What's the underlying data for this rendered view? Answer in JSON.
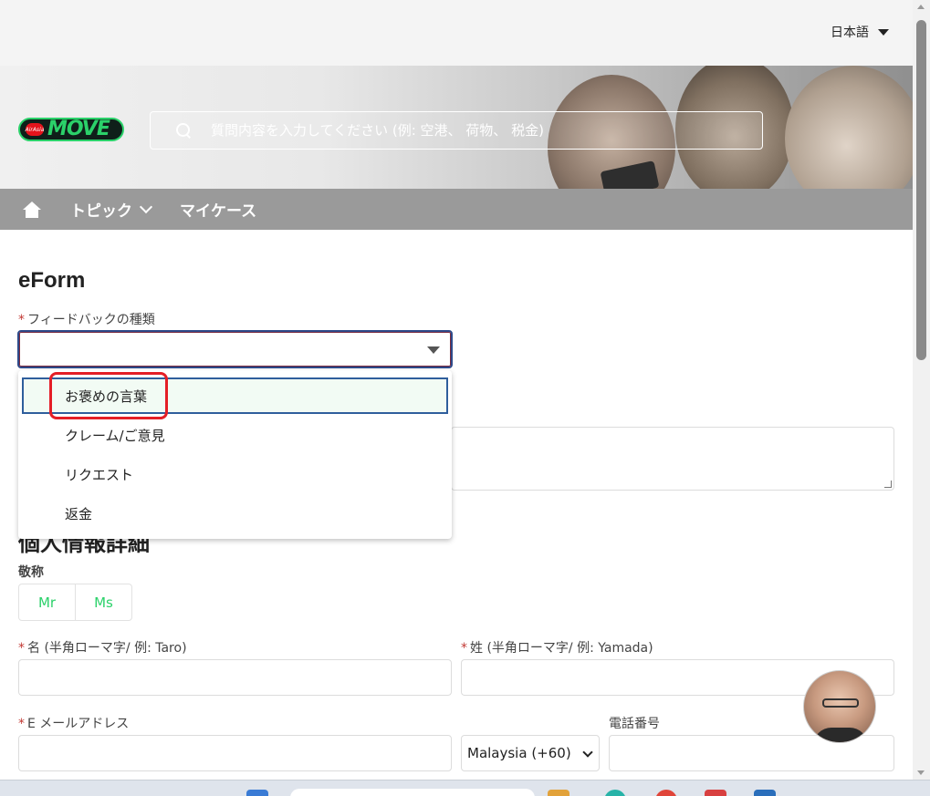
{
  "header": {
    "language": "日本語"
  },
  "search": {
    "placeholder": "質問内容を入力してください (例: 空港、 荷物、 税金)"
  },
  "nav": {
    "topics": "トピック",
    "my_cases": "マイケース"
  },
  "form": {
    "title": "eForm",
    "feedback_type_label": "フィードバックの種類",
    "feedback_options": [
      "お褒めの言葉",
      "クレーム/ご意見",
      "リクエスト",
      "返金"
    ],
    "selected_option_index": 0,
    "section_title": "個人情報詳細",
    "salutation_label": "敬称",
    "salutations": [
      "Mr",
      "Ms"
    ],
    "first_name_label": "名 (半角ローマ字/ 例: Taro)",
    "last_name_label": "姓 (半角ローマ字/ 例: Yamada)",
    "email_label": "E メールアドレス",
    "phone_label": "電話番号",
    "country_code": "Malaysia (+60)",
    "required_mark": "*"
  },
  "colors": {
    "accent": "#2bd16a",
    "required": "#c23934",
    "highlight": "#e41e26",
    "nav_bg": "#9a9a9a"
  }
}
